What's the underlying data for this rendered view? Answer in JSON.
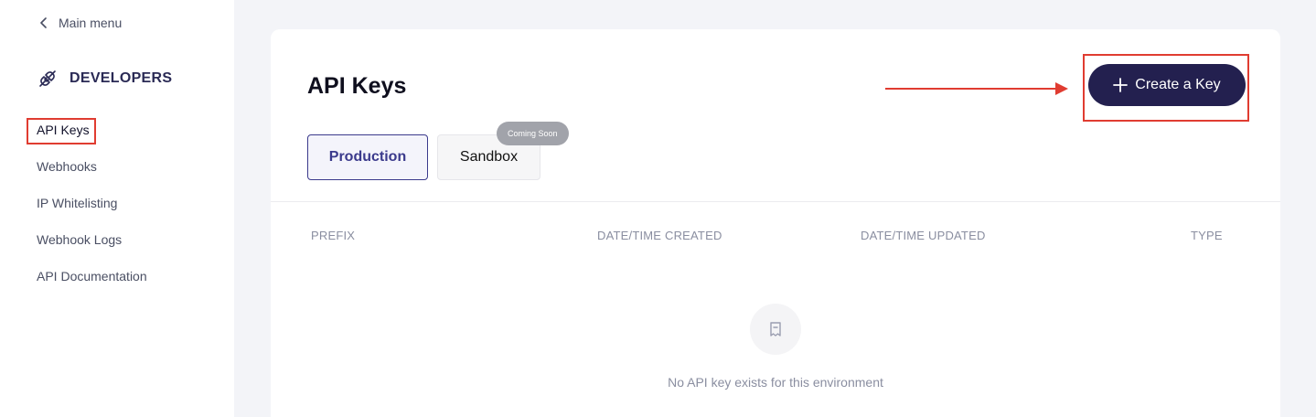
{
  "sidebar": {
    "back_label": "Main menu",
    "section_title": "DEVELOPERS",
    "items": [
      {
        "label": "API Keys"
      },
      {
        "label": "Webhooks"
      },
      {
        "label": "IP Whitelisting"
      },
      {
        "label": "Webhook Logs"
      },
      {
        "label": "API Documentation"
      }
    ]
  },
  "main": {
    "title": "API Keys",
    "create_button_label": "Create a Key",
    "tabs": [
      {
        "label": "Production"
      },
      {
        "label": "Sandbox"
      }
    ],
    "sandbox_badge": "Coming Soon",
    "table": {
      "columns": [
        "PREFIX",
        "DATE/TIME CREATED",
        "DATE/TIME UPDATED",
        "TYPE"
      ]
    },
    "empty_message": "No API key exists for this environment"
  },
  "colors": {
    "accent": "#23204f",
    "tab_active": "#3b3a8c",
    "annotation": "#e03c31",
    "background": "#f3f4f8"
  },
  "icons": {
    "back": "chevron-left-icon",
    "section": "plug-icon",
    "create": "plus-icon",
    "empty": "document-icon"
  }
}
